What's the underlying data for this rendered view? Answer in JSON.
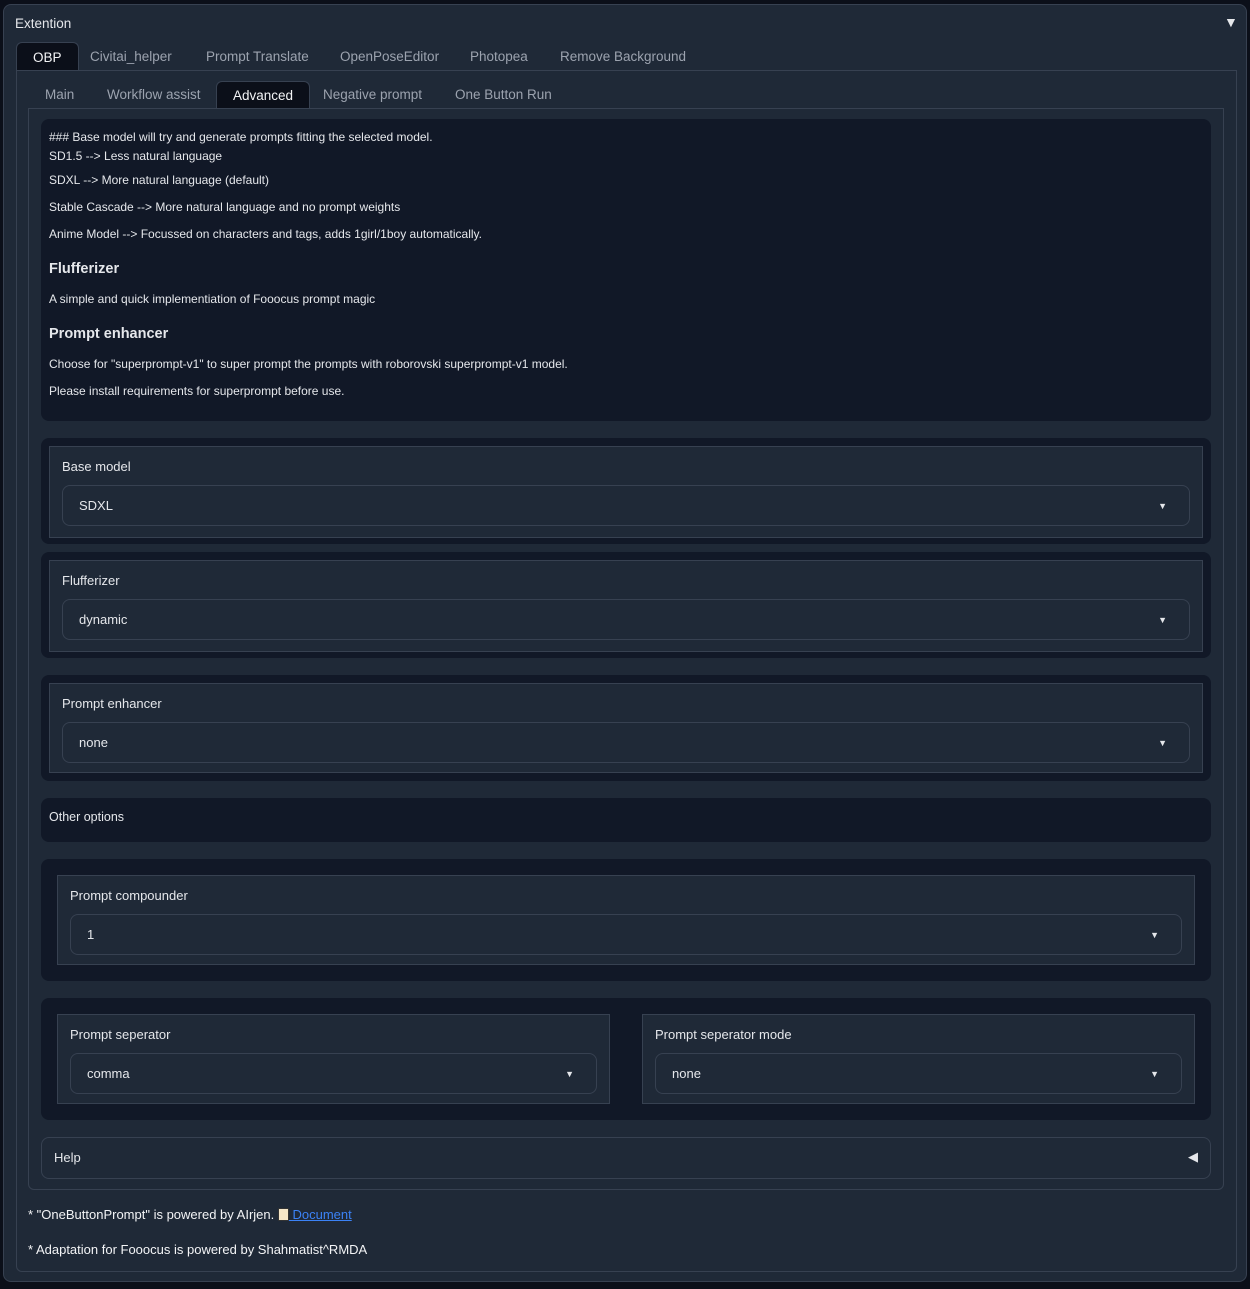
{
  "accordion": {
    "title": "Extention",
    "toggle_icon": "triangle-down"
  },
  "tabs": [
    "OBP",
    "Civitai_helper",
    "Prompt Translate",
    "OpenPoseEditor",
    "Photopea",
    "Remove Background"
  ],
  "subtabs": [
    "Main",
    "Workflow assist",
    "Advanced",
    "Negative prompt",
    "One Button Run"
  ],
  "info": {
    "lines1": [
      "### Base model will try and generate prompts fitting the selected model.",
      "SD1.5 --> Less natural language",
      "SDXL --> More natural language (default)",
      "Stable Cascade --> More natural language and no prompt weights",
      "Anime Model --> Focussed on characters and tags, adds 1girl/1boy automatically."
    ],
    "h_fluff": "Flufferizer",
    "fluff_text": "A simple and quick implementiation of Fooocus prompt magic",
    "h_enh": "Prompt enhancer",
    "enh_lines": [
      "Choose for \"superprompt-v1\" to super prompt the prompts with roborovski superprompt-v1 model.",
      "Please install requirements for superprompt before use."
    ]
  },
  "base_model": {
    "label": "Base model",
    "value": "SDXL"
  },
  "flufferizer": {
    "label": "Flufferizer",
    "value": "dynamic"
  },
  "prompt_enhancer": {
    "label": "Prompt enhancer",
    "value": "none"
  },
  "other_options": "Other options",
  "prompt_compounder": {
    "label": "Prompt compounder",
    "value": "1"
  },
  "prompt_separator": {
    "label": "Prompt seperator",
    "value": "comma"
  },
  "prompt_separator_mode": {
    "label": "Prompt seperator mode",
    "value": "none"
  },
  "help": {
    "label": "Help"
  },
  "footer": {
    "line1": "* \"OneButtonPrompt\" is powered by AIrjen.",
    "doc_link": "Document",
    "line2": "* Adaptation for Fooocus is powered by Shahmatist^RMDA"
  }
}
